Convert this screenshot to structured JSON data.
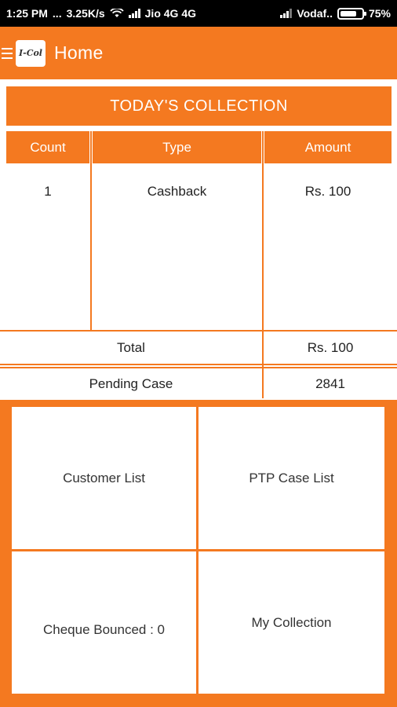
{
  "status_bar": {
    "time": "1:25 PM",
    "dots": "...",
    "speed": "3.25K/s",
    "carrier1": "Jio 4G 4G",
    "carrier2": "Vodaf..",
    "battery": "75%",
    "battery_level": 0.75
  },
  "app_bar": {
    "logo_text": "I-Col",
    "title": "Home"
  },
  "collection": {
    "header": "TODAY'S COLLECTION",
    "columns": [
      "Count",
      "Type",
      "Amount"
    ],
    "rows": [
      {
        "count": "1",
        "type": "Cashback",
        "amount": "Rs. 100"
      }
    ],
    "total_label": "Total",
    "total_value": "Rs. 100",
    "pending_label": "Pending Case",
    "pending_value": "2841"
  },
  "menu_tiles": {
    "customer_list": "Customer List",
    "ptp_case_list": "PTP Case List",
    "cheque_bounced": "Cheque Bounced : 0",
    "my_collection": "My Collection"
  },
  "colors": {
    "accent": "#f47920",
    "status_bar": "#000000"
  }
}
